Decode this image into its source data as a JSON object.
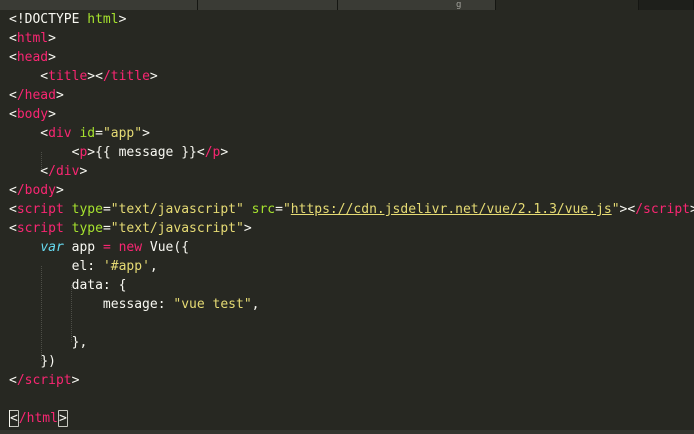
{
  "tabs": [
    {
      "label": ""
    },
    {
      "label": ""
    },
    {
      "label": "g"
    },
    {
      "label": ""
    },
    {
      "label": ""
    }
  ],
  "code": {
    "l1_doctype": "<!DOCTYPE",
    "l1_html": " html",
    "l1_close": ">",
    "html_open": "html",
    "head_open": "head",
    "title_open": "title",
    "title_close": "/title",
    "head_close": "/head",
    "body_open": "body",
    "div_tag": "div",
    "id_attr": "id",
    "app_id_value": "\"app\"",
    "p_open": "p",
    "message_expr": "{{ message }}",
    "p_close": "/p",
    "div_close": "/div",
    "body_close": "/body",
    "script_tag": "script",
    "type_attr": "type",
    "type_value": "\"text/javascript\"",
    "src_attr": "src",
    "src_value": "https://cdn.jsdelivr.net/vue/2.1.3/vue.js",
    "script_close": "/script",
    "var_kw": "var",
    "app_name": " app ",
    "eq": "=",
    "new_kw": "new",
    "vue_call": " Vue({",
    "el_key": "el: ",
    "el_value": "'#app'",
    "comma": ",",
    "data_key": "data: {",
    "message_key": "message: ",
    "message_value": "\"vue test\"",
    "data_close": "},",
    "vue_close": "})",
    "html_close": "/html"
  },
  "colors": {
    "background": "#272822",
    "text": "#f8f8f2",
    "tag": "#f92672",
    "attribute": "#a6e22e",
    "string": "#e6db74",
    "keyword": "#66d9ef"
  }
}
